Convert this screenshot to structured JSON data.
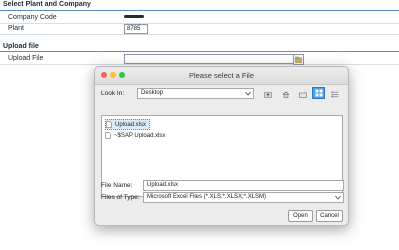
{
  "section1": {
    "title": "Select Plant and Company",
    "company_code_label": "Company Code",
    "plant_label": "Plant",
    "plant_value": "8785"
  },
  "section2": {
    "title": "Upload file",
    "upload_label": "Upload File",
    "upload_value": ""
  },
  "dialog": {
    "title": "Please select a File",
    "look_in_label": "Look In:",
    "look_in_value": "Desktop",
    "files": [
      "Upload.xlsx",
      "~$SAP Upload.xlsx"
    ],
    "selected_file_index": 0,
    "file_name_label": "File Name:",
    "file_name_value": "Upload.xlsx",
    "files_of_type_label": "Files of Type:",
    "files_of_type_value": "Microsoft Excel Files (*.XLS;*.XLSX;*.XLSM)",
    "open_label": "Open",
    "cancel_label": "Cancel"
  },
  "colors": {
    "accent": "#4aa0e8",
    "section_rule": "#5a8fc4",
    "close": "#fe5f57",
    "minimize": "#febc2e",
    "maximize": "#28c840"
  }
}
